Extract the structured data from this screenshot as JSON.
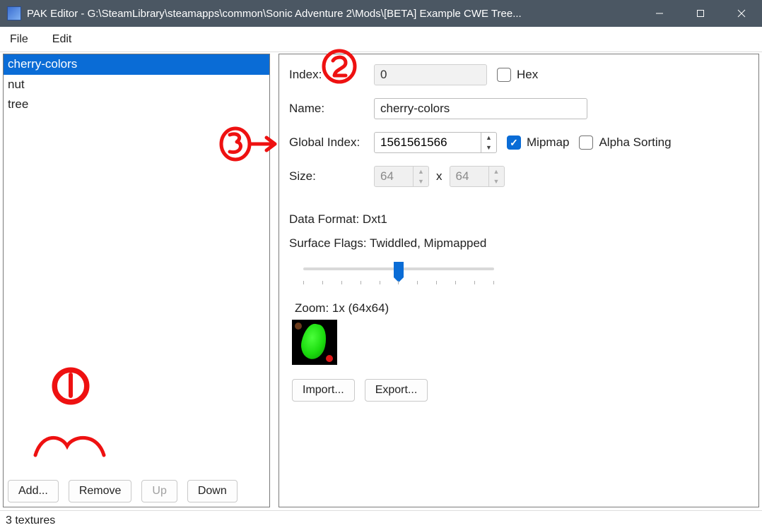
{
  "window": {
    "title": "PAK Editor - G:\\SteamLibrary\\steamapps\\common\\Sonic Adventure 2\\Mods\\[BETA] Example CWE Tree..."
  },
  "menu": {
    "file": "File",
    "edit": "Edit"
  },
  "list": {
    "items": [
      "cherry-colors",
      "nut",
      "tree"
    ],
    "selected_index": 0
  },
  "left_buttons": {
    "add": "Add...",
    "remove": "Remove",
    "up": "Up",
    "down": "Down"
  },
  "form": {
    "index_label": "Index:",
    "index_value": "0",
    "hex_label": "Hex",
    "hex_checked": false,
    "name_label": "Name:",
    "name_value": "cherry-colors",
    "gindex_label": "Global Index:",
    "gindex_value": "1561561566",
    "mipmap_label": "Mipmap",
    "mipmap_checked": true,
    "alpha_label": "Alpha Sorting",
    "alpha_checked": false,
    "size_label": "Size:",
    "size_w": "64",
    "size_h": "64",
    "data_format": "Data Format: Dxt1",
    "surface_flags": "Surface Flags: Twiddled, Mipmapped",
    "zoom": "Zoom: 1x (64x64)",
    "import": "Import...",
    "export": "Export..."
  },
  "status": "3 textures",
  "annotations": {
    "mark1": "1",
    "mark2": "2",
    "mark3": "3"
  }
}
